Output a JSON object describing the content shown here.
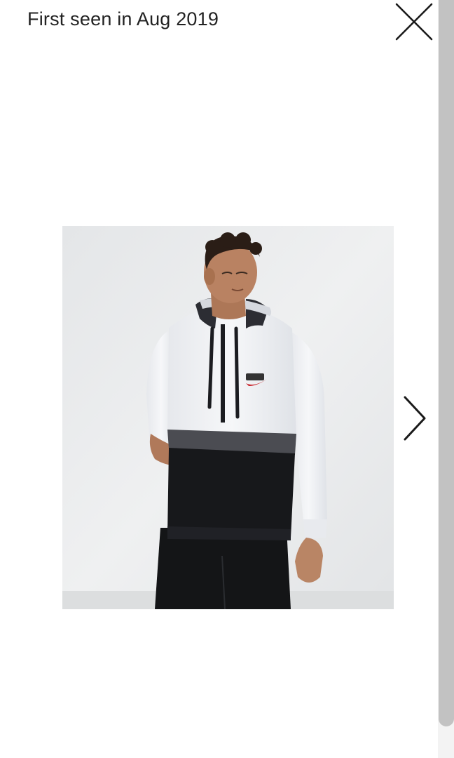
{
  "header": {
    "title": "First seen in Aug 2019"
  },
  "icons": {
    "close": "close-icon",
    "next": "chevron-right-icon"
  },
  "photo": {
    "subject": "product-photo"
  },
  "colors": {
    "text": "#222222",
    "background": "#ffffff",
    "scrollbar_thumb": "#c2c2c2",
    "scrollbar_track": "#f3f3f3"
  }
}
